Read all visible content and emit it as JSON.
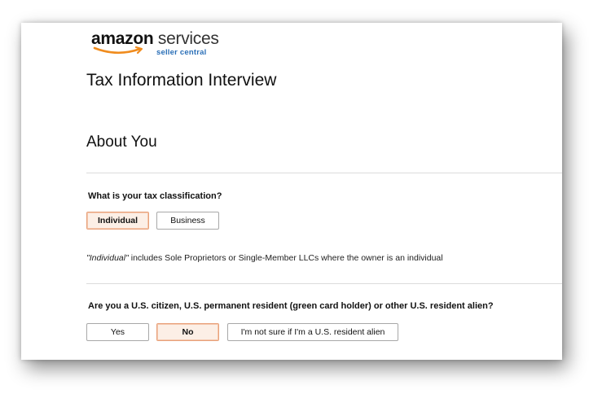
{
  "header": {
    "logo_brand": "amazon",
    "logo_product": " services",
    "logo_subtitle": "seller central"
  },
  "page": {
    "title": "Tax Information Interview",
    "section_title": "About You"
  },
  "tax_classification": {
    "question": "What is your tax classification?",
    "options": [
      "Individual",
      "Business"
    ],
    "selected": "Individual",
    "note_italic": "\"Individual\"",
    "note_rest": " includes Sole Proprietors or Single-Member LLCs where the owner is an individual"
  },
  "residency": {
    "question": "Are you a U.S. citizen, U.S. permanent resident (green card holder) or other U.S. resident alien?",
    "options": [
      "Yes",
      "No",
      "I'm not sure if I'm a U.S. resident alien"
    ],
    "selected": "No"
  },
  "colors": {
    "selected_bg": "#fcefe6",
    "selected_border": "#e8a17a",
    "logo_smile": "#f08c1e",
    "logo_subtitle": "#2a6fb7"
  }
}
